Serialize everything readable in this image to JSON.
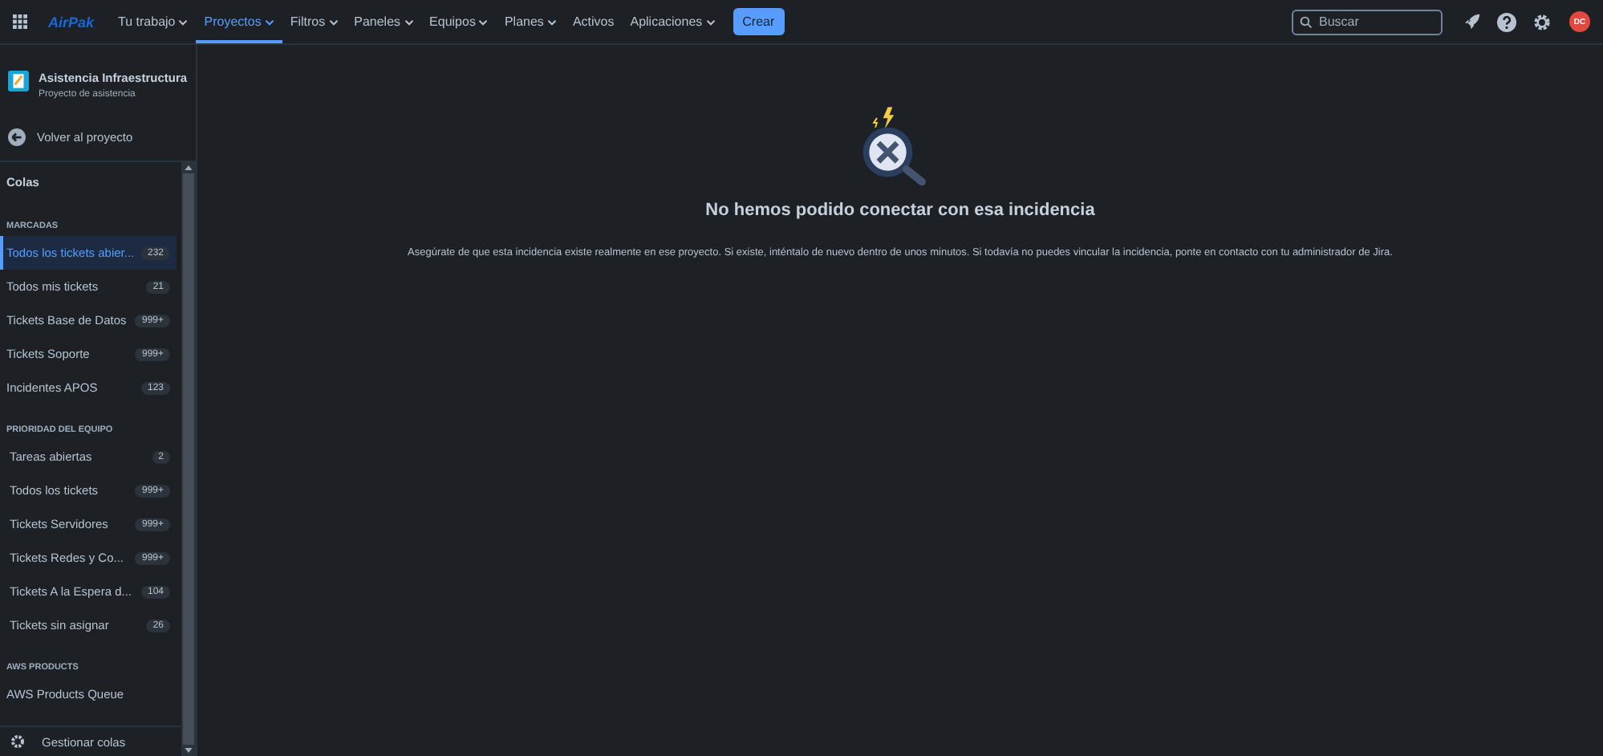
{
  "topbar": {
    "logo": "AirPak",
    "nav": [
      {
        "label": "Tu trabajo",
        "dropdown": true,
        "selected": false
      },
      {
        "label": "Proyectos",
        "dropdown": true,
        "selected": true
      },
      {
        "label": "Filtros",
        "dropdown": true,
        "selected": false
      },
      {
        "label": "Paneles",
        "dropdown": true,
        "selected": false
      },
      {
        "label": "Equipos",
        "dropdown": true,
        "selected": false
      },
      {
        "label": "Planes",
        "dropdown": true,
        "selected": false
      },
      {
        "label": "Activos",
        "dropdown": false,
        "selected": false
      },
      {
        "label": "Aplicaciones",
        "dropdown": true,
        "selected": false
      }
    ],
    "create_button": "Crear",
    "search": {
      "placeholder": "Buscar"
    },
    "avatar": "DC"
  },
  "sidebar": {
    "project": {
      "name": "Asistencia Infraestructura",
      "type": "Proyecto de asistencia"
    },
    "back_link": "Volver al proyecto",
    "heading": "Colas",
    "sections": [
      {
        "title": "MARCADAS",
        "items": [
          {
            "label": "Todos los tickets abier...",
            "count": "232",
            "selected": true
          },
          {
            "label": "Todos mis tickets",
            "count": "21",
            "selected": false
          },
          {
            "label": "Tickets Base de Datos",
            "count": "999+",
            "selected": false
          },
          {
            "label": "Tickets Soporte",
            "count": "999+",
            "selected": false
          },
          {
            "label": "Incidentes APOS",
            "count": "123",
            "selected": false
          }
        ]
      },
      {
        "title": "PRIORIDAD DEL EQUIPO",
        "items": [
          {
            "label": "Tareas abiertas",
            "count": "2",
            "selected": false
          },
          {
            "label": "Todos los tickets",
            "count": "999+",
            "selected": false
          },
          {
            "label": "Tickets Servidores",
            "count": "999+",
            "selected": false
          },
          {
            "label": "Tickets Redes y Co...",
            "count": "999+",
            "selected": false
          },
          {
            "label": "Tickets A la Espera d...",
            "count": "104",
            "selected": false
          },
          {
            "label": "Tickets sin asignar",
            "count": "26",
            "selected": false
          }
        ]
      },
      {
        "title": "AWS PRODUCTS",
        "items": [
          {
            "label": "AWS Products Queue",
            "selected": false
          }
        ]
      }
    ],
    "manage_link": "Gestionar colas"
  },
  "error": {
    "title": "No hemos podido conectar con esa incidencia",
    "message": "Asegúrate de que esta incidencia existe realmente en ese proyecto. Si existe, inténtalo de nuevo dentro de unos minutos. Si todavía no puedes vincular la incidencia, ponte en contacto con tu administrador de Jira."
  }
}
